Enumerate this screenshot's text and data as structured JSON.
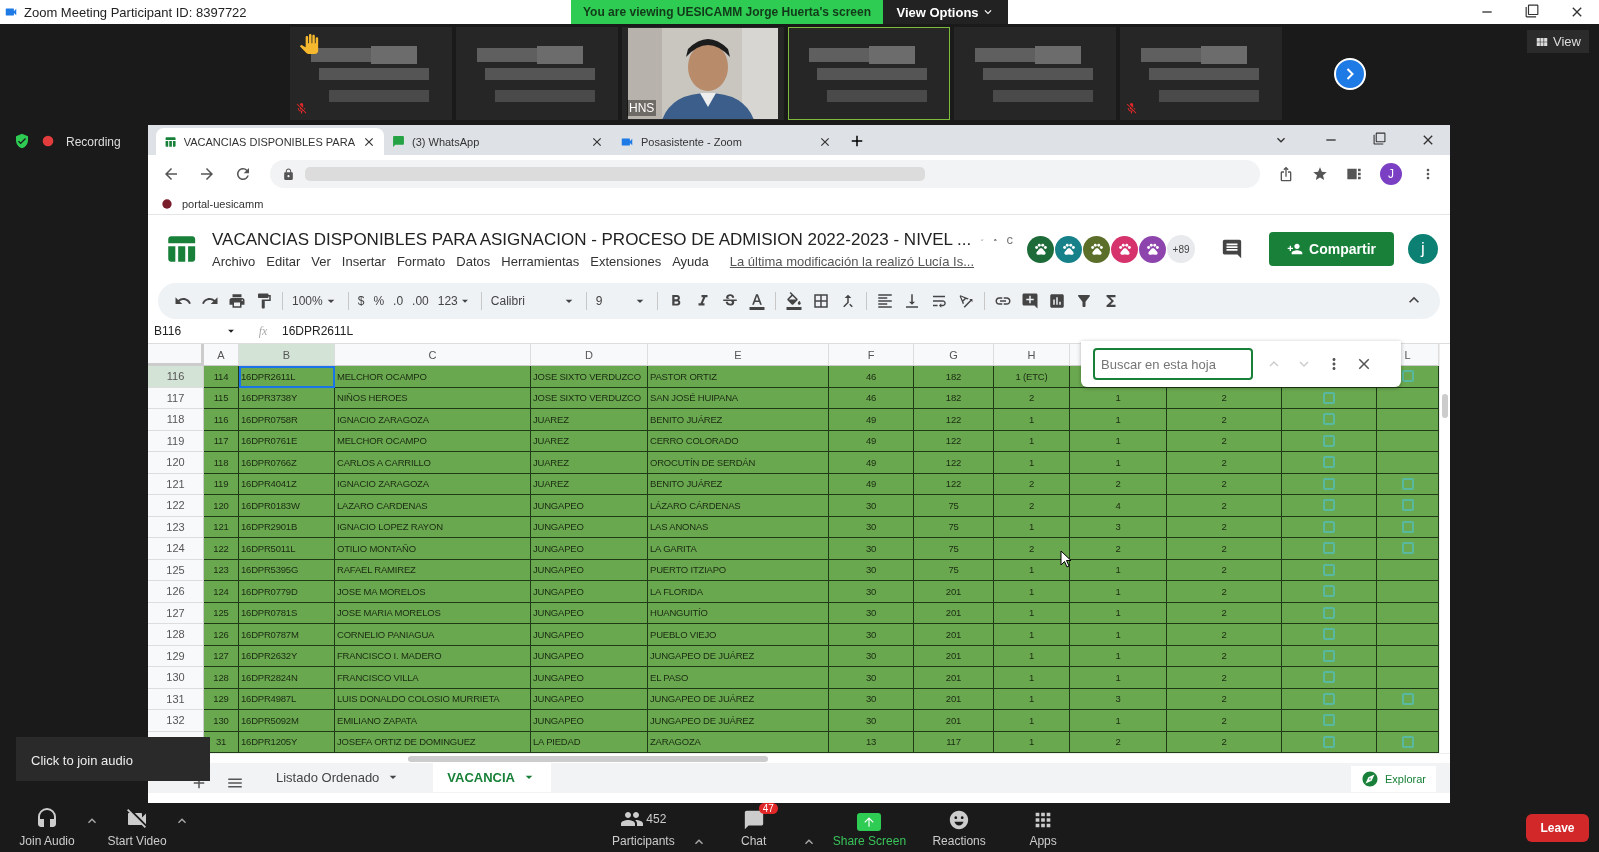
{
  "window": {
    "title": "Zoom Meeting Participant ID: 8397722"
  },
  "share_banner": {
    "text": "You are viewing UESICAMM Jorge Huerta's screen",
    "options": "View Options"
  },
  "view_button": "View",
  "tiles": [
    {
      "kind": "blurred",
      "hand_raised": true,
      "muted": true,
      "speaking": false
    },
    {
      "kind": "blurred",
      "hand_raised": false,
      "muted": false,
      "speaking": false
    },
    {
      "kind": "video",
      "label": "HNS",
      "hand_raised": false,
      "muted": false,
      "speaking": false
    },
    {
      "kind": "blurred",
      "hand_raised": false,
      "muted": false,
      "speaking": true
    },
    {
      "kind": "blurred",
      "hand_raised": false,
      "muted": false,
      "speaking": false
    },
    {
      "kind": "blurred",
      "hand_raised": false,
      "muted": true,
      "speaking": false
    }
  ],
  "recording": "Recording",
  "browser": {
    "tabs": [
      {
        "label": "VACANCIAS DISPONIBLES PARA",
        "selected": true
      },
      {
        "label": "(3) WhatsApp",
        "selected": false
      },
      {
        "label": "Posasistente - Zoom",
        "selected": false
      }
    ],
    "profile": "J",
    "bookmark": "portal-uesicamm"
  },
  "sheet": {
    "title": "VACANCIAS DISPONIBLES PARA ASIGNACION - PROCESO DE ADMISION 2022-2023 - NIVEL ...",
    "title_cut": "c",
    "menu": [
      "Archivo",
      "Editar",
      "Ver",
      "Insertar",
      "Formato",
      "Datos",
      "Herramientas",
      "Extensiones",
      "Ayuda"
    ],
    "last_edit": "La última modificación la realizó Lucía Is...",
    "avatars": [
      {
        "color": "#1e6b3a"
      },
      {
        "color": "#17818a"
      },
      {
        "color": "#5b6f2a"
      },
      {
        "color": "#d6336c"
      },
      {
        "color": "#8e44ad"
      }
    ],
    "more_viewers": "+89",
    "share": "Compartir",
    "user": "j",
    "toolbar": {
      "zoom": "100%",
      "currency": "$",
      "percent": "%",
      "dec_less": ".0",
      "dec_more": ".00",
      "format": "123",
      "font": "Calibri",
      "size": "9"
    },
    "name_box": "B116",
    "fx": "fx",
    "formula": "16DPR2611L",
    "columns": [
      {
        "label": "A",
        "selected": false
      },
      {
        "label": "B",
        "selected": true
      },
      {
        "label": "C",
        "selected": false
      },
      {
        "label": "D",
        "selected": false
      },
      {
        "label": "E",
        "selected": false
      },
      {
        "label": "F",
        "selected": false
      },
      {
        "label": "G",
        "selected": false
      },
      {
        "label": "H",
        "selected": false
      },
      {
        "label": "L",
        "selected": false
      }
    ],
    "rows": [
      {
        "row": "116",
        "selected": true,
        "cells": [
          "114",
          "16DPR2611L",
          "MELCHOR OCAMPO",
          "JOSE SIXTO VERDUZCO",
          "PASTOR ORTIZ",
          "46",
          "182",
          "1 (ETC)"
        ],
        "l": {
          "checked": false
        }
      },
      {
        "row": "117",
        "selected": false,
        "cells": [
          "115",
          "16DPR3738Y",
          "NIÑOS HEROES",
          "JOSE SIXTO VERDUZCO",
          "SAN JOSÉ HUIPANA",
          "46",
          "182",
          "2",
          "1",
          "2"
        ],
        "k": {
          "checked": false
        }
      },
      {
        "row": "118",
        "selected": false,
        "cells": [
          "116",
          "16DPR0758R",
          "IGNACIO ZARAGOZA",
          "JUAREZ",
          "BENITO JUÁREZ",
          "49",
          "122",
          "1",
          "1",
          "2"
        ],
        "k": {
          "checked": false
        }
      },
      {
        "row": "119",
        "selected": false,
        "cells": [
          "117",
          "16DPR0761E",
          "MELCHOR OCAMPO",
          "JUAREZ",
          "CERRO COLORADO",
          "49",
          "122",
          "1",
          "1",
          "2"
        ],
        "k": {
          "checked": false
        }
      },
      {
        "row": "120",
        "selected": false,
        "cells": [
          "118",
          "16DPR0766Z",
          "CARLOS A CARRILLO",
          "JUAREZ",
          "OROCUTÍN DE SERDÁN",
          "49",
          "122",
          "1",
          "1",
          "2"
        ],
        "k": {
          "checked": false
        }
      },
      {
        "row": "121",
        "selected": false,
        "cells": [
          "119",
          "16DPR4041Z",
          "IGNACIO ZARAGOZA",
          "JUAREZ",
          "BENITO JUÁREZ",
          "49",
          "122",
          "2",
          "2",
          "2"
        ],
        "k": {
          "checked": false
        },
        "l": {
          "checked": false
        }
      },
      {
        "row": "122",
        "selected": false,
        "cells": [
          "120",
          "16DPR0183W",
          "LAZARO CARDENAS",
          "JUNGAPEO",
          "LÁZARO CÁRDENAS",
          "30",
          "75",
          "2",
          "4",
          "2"
        ],
        "k": {
          "checked": false
        },
        "l": {
          "checked": false
        }
      },
      {
        "row": "123",
        "selected": false,
        "cells": [
          "121",
          "16DPR2901B",
          "IGNACIO LOPEZ RAYON",
          "JUNGAPEO",
          "LAS ANONAS",
          "30",
          "75",
          "1",
          "3",
          "2"
        ],
        "k": {
          "checked": false
        },
        "l": {
          "checked": false
        }
      },
      {
        "row": "124",
        "selected": false,
        "cells": [
          "122",
          "16DPR5011L",
          "OTILIO MONTAÑO",
          "JUNGAPEO",
          "LA GARITA",
          "30",
          "75",
          "2",
          "2",
          "2"
        ],
        "k": {
          "checked": false
        },
        "l": {
          "checked": false
        }
      },
      {
        "row": "125",
        "selected": false,
        "cells": [
          "123",
          "16DPR5395G",
          "RAFAEL RAMIREZ",
          "JUNGAPEO",
          "PUERTO ITZIAPO",
          "30",
          "75",
          "1",
          "1",
          "2"
        ],
        "k": {
          "checked": false
        }
      },
      {
        "row": "126",
        "selected": false,
        "cells": [
          "124",
          "16DPR0779D",
          "JOSE MA MORELOS",
          "JUNGAPEO",
          "LA FLORIDA",
          "30",
          "201",
          "1",
          "1",
          "2"
        ],
        "k": {
          "checked": false
        }
      },
      {
        "row": "127",
        "selected": false,
        "cells": [
          "125",
          "16DPR0781S",
          "JOSE MARIA MORELOS",
          "JUNGAPEO",
          "HUANGUITÍO",
          "30",
          "201",
          "1",
          "1",
          "2"
        ],
        "k": {
          "checked": false
        }
      },
      {
        "row": "128",
        "selected": false,
        "cells": [
          "126",
          "16DPR0787M",
          "CORNELIO PANIAGUA",
          "JUNGAPEO",
          "PUEBLO VIEJO",
          "30",
          "201",
          "1",
          "1",
          "2"
        ],
        "k": {
          "checked": false
        }
      },
      {
        "row": "129",
        "selected": false,
        "cells": [
          "127",
          "16DPR2632Y",
          "FRANCISCO I. MADERO",
          "JUNGAPEO",
          "JUNGAPEO DE JUÁREZ",
          "30",
          "201",
          "1",
          "1",
          "2"
        ],
        "k": {
          "checked": false
        }
      },
      {
        "row": "130",
        "selected": false,
        "cells": [
          "128",
          "16DPR2824N",
          "FRANCISCO VILLA",
          "JUNGAPEO",
          "EL PASO",
          "30",
          "201",
          "1",
          "1",
          "2"
        ],
        "k": {
          "checked": false
        }
      },
      {
        "row": "131",
        "selected": false,
        "cells": [
          "129",
          "16DPR4987L",
          "LUIS DONALDO COLOSIO MURRIETA",
          "JUNGAPEO",
          "JUNGAPEO DE JUÁREZ",
          "30",
          "201",
          "1",
          "3",
          "2"
        ],
        "k": {
          "checked": false
        },
        "l": {
          "checked": false
        }
      },
      {
        "row": "132",
        "selected": false,
        "cells": [
          "130",
          "16DPR5092M",
          "EMILIANO ZAPATA",
          "JUNGAPEO",
          "JUNGAPEO DE JUÁREZ",
          "30",
          "201",
          "1",
          "1",
          "2"
        ],
        "k": {
          "checked": false
        }
      },
      {
        "selected": false,
        "cells": [
          "31",
          "16DPR1205Y",
          "JOSEFA ORTIZ DE DOMINGUEZ",
          "LA PIEDAD",
          "ZARAGOZA",
          "13",
          "117",
          "1",
          "2",
          "2"
        ],
        "k": {
          "checked": false
        },
        "l": {
          "checked": false
        }
      }
    ],
    "find": {
      "placeholder": "Buscar en esta hoja"
    },
    "sheet_tabs": [
      {
        "label": "Listado Ordenado",
        "selected": false
      },
      {
        "label": "VACANCIA",
        "selected": true
      }
    ],
    "explore": "Explorar"
  },
  "tooltip": "Click to join audio",
  "controls": {
    "left": [
      {
        "kind": "audio",
        "label": "Join Audio"
      },
      {
        "kind": "video",
        "label": "Start Video"
      }
    ],
    "center": [
      {
        "kind": "participants",
        "label": "Participants",
        "count": "452"
      },
      {
        "kind": "chat",
        "label": "Chat",
        "badge": "47"
      },
      {
        "kind": "share",
        "label": "Share Screen"
      },
      {
        "kind": "reactions",
        "label": "Reactions"
      },
      {
        "kind": "apps",
        "label": "Apps"
      }
    ],
    "leave": "Leave"
  }
}
